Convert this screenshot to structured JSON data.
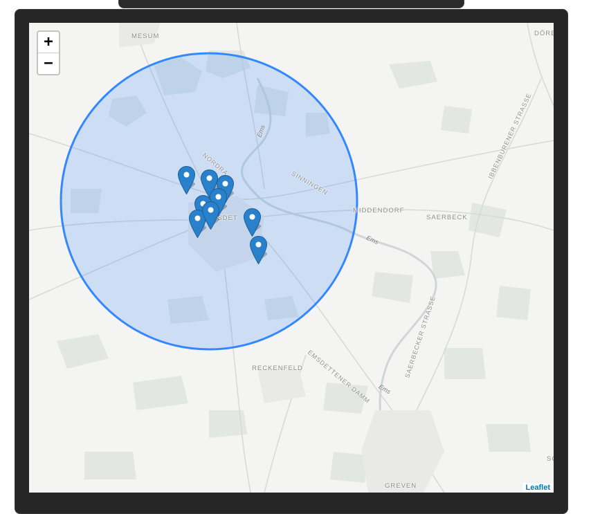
{
  "map": {
    "zoom_in_label": "+",
    "zoom_out_label": "−",
    "attribution": "Leaflet",
    "places": [
      "MESUM",
      "NORDRA",
      "SINNINGEN",
      "EMSDET",
      "MIDDENDORF",
      "SAERBECK",
      "RECKENFELD",
      "GREVEN",
      "DÖRE",
      "SC"
    ],
    "roads": [
      "IBBENBURENER STRASSE",
      "SAERBECKER STRASSE",
      "EMSDETTENER DAMM"
    ],
    "rivers": [
      "Ems",
      "Ems",
      "Ems"
    ],
    "radius_circle": {
      "fill": "#3388ff",
      "stroke": "#3388ff"
    },
    "marker_count": 9,
    "marker_color": "#2a81cb"
  }
}
